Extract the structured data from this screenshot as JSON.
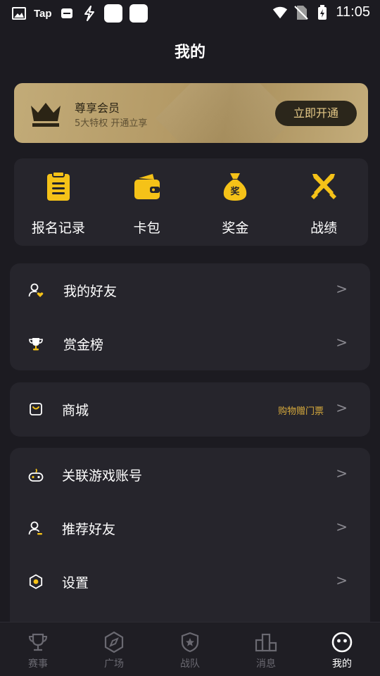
{
  "status_bar": {
    "time": "11:05",
    "tap_label": "Tap"
  },
  "page": {
    "title": "我的"
  },
  "member_banner": {
    "title": "尊享会员",
    "subtitle": "5大特权 开通立享",
    "button_label": "立即开通"
  },
  "quick_actions": [
    {
      "label": "报名记录",
      "icon": "clipboard-icon"
    },
    {
      "label": "卡包",
      "icon": "wallet-icon"
    },
    {
      "label": "奖金",
      "icon": "money-bag-icon"
    },
    {
      "label": "战绩",
      "icon": "crossed-swords-icon"
    }
  ],
  "menu_group_1": [
    {
      "label": "我的好友",
      "icon": "friend-heart-icon",
      "arrow": ">"
    },
    {
      "label": "赏金榜",
      "icon": "trophy-icon",
      "arrow": ">"
    }
  ],
  "menu_group_2": [
    {
      "label": "商城",
      "icon": "shop-bag-icon",
      "note": "购物赠门票",
      "arrow": ">"
    }
  ],
  "menu_group_3": [
    {
      "label": "关联游戏账号",
      "icon": "gamepad-icon",
      "arrow": ">"
    },
    {
      "label": "推荐好友",
      "icon": "recommend-user-icon",
      "arrow": ">"
    },
    {
      "label": "设置",
      "icon": "settings-icon",
      "arrow": ">"
    }
  ],
  "tab_bar": [
    {
      "label": "赛事",
      "icon": "trophy-cup-icon",
      "active": false
    },
    {
      "label": "广场",
      "icon": "compass-icon",
      "active": false
    },
    {
      "label": "战队",
      "icon": "shield-star-icon",
      "active": false
    },
    {
      "label": "消息",
      "icon": "podium-icon",
      "active": false
    },
    {
      "label": "我的",
      "icon": "smiley-face-icon",
      "active": true
    }
  ],
  "colors": {
    "background": "#1c1b21",
    "card": "#26252c",
    "accent_yellow": "#f5c218",
    "gold_banner": "#c2ab78",
    "note_text": "#d6a93c"
  }
}
